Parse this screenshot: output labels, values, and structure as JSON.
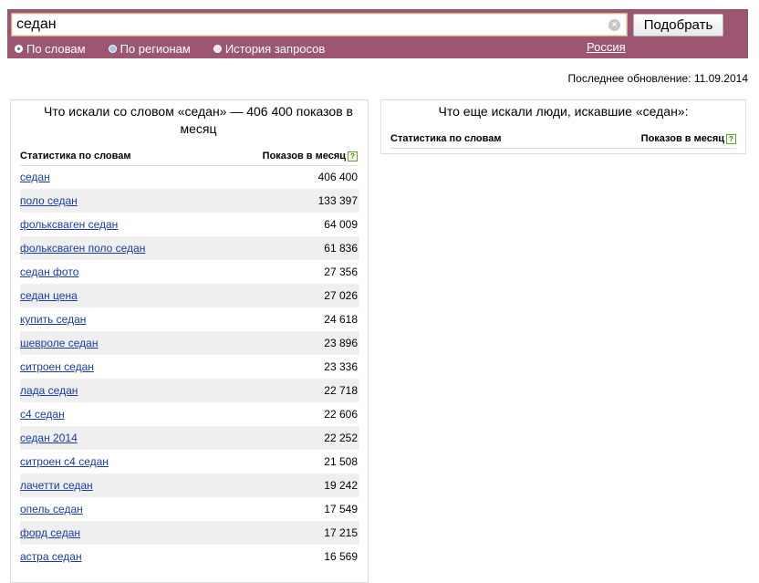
{
  "search": {
    "query": "седан",
    "clear_icon": "×",
    "submit_label": "Подобрать"
  },
  "modes": [
    {
      "label": "По словам",
      "selected": true
    },
    {
      "label": "По регионам",
      "selected": false
    },
    {
      "label": "История запросов",
      "selected": false
    }
  ],
  "region": "Россия",
  "updated": "Последнее обновление: 11.09.2014",
  "left_panel": {
    "title": "Что искали со словом «седан» — 406 400 показов в месяц",
    "col_phrase": "Статистика по словам",
    "col_count": "Показов в месяц",
    "help_icon": "?",
    "rows": [
      {
        "phrase": "седан",
        "count": "406 400"
      },
      {
        "phrase": "поло седан",
        "count": "133 397"
      },
      {
        "phrase": "фольксваген седан",
        "count": "64 009"
      },
      {
        "phrase": "фольксваген поло седан",
        "count": "61 836"
      },
      {
        "phrase": "седан фото",
        "count": "27 356"
      },
      {
        "phrase": "седан цена",
        "count": "27 026"
      },
      {
        "phrase": "купить седан",
        "count": "24 618"
      },
      {
        "phrase": "шевроле седан",
        "count": "23 896"
      },
      {
        "phrase": "ситроен седан",
        "count": "23 336"
      },
      {
        "phrase": "лада седан",
        "count": "22 718"
      },
      {
        "phrase": "с4 седан",
        "count": "22 606"
      },
      {
        "phrase": "седан 2014",
        "count": "22 252"
      },
      {
        "phrase": "ситроен с4 седан",
        "count": "21 508"
      },
      {
        "phrase": "лачетти седан",
        "count": "19 242"
      },
      {
        "phrase": "опель седан",
        "count": "17 549"
      },
      {
        "phrase": "форд седан",
        "count": "17 215"
      },
      {
        "phrase": "астра седан",
        "count": "16 569"
      }
    ]
  },
  "right_panel": {
    "title": "Что еще искали люди, искавшие «седан»:",
    "col_phrase": "Статистика по словам",
    "col_count": "Показов в месяц",
    "help_icon": "?"
  },
  "colors": {
    "topbar": "#9d5671",
    "link": "#1b3ba1",
    "row_stripe": "#efefef"
  }
}
